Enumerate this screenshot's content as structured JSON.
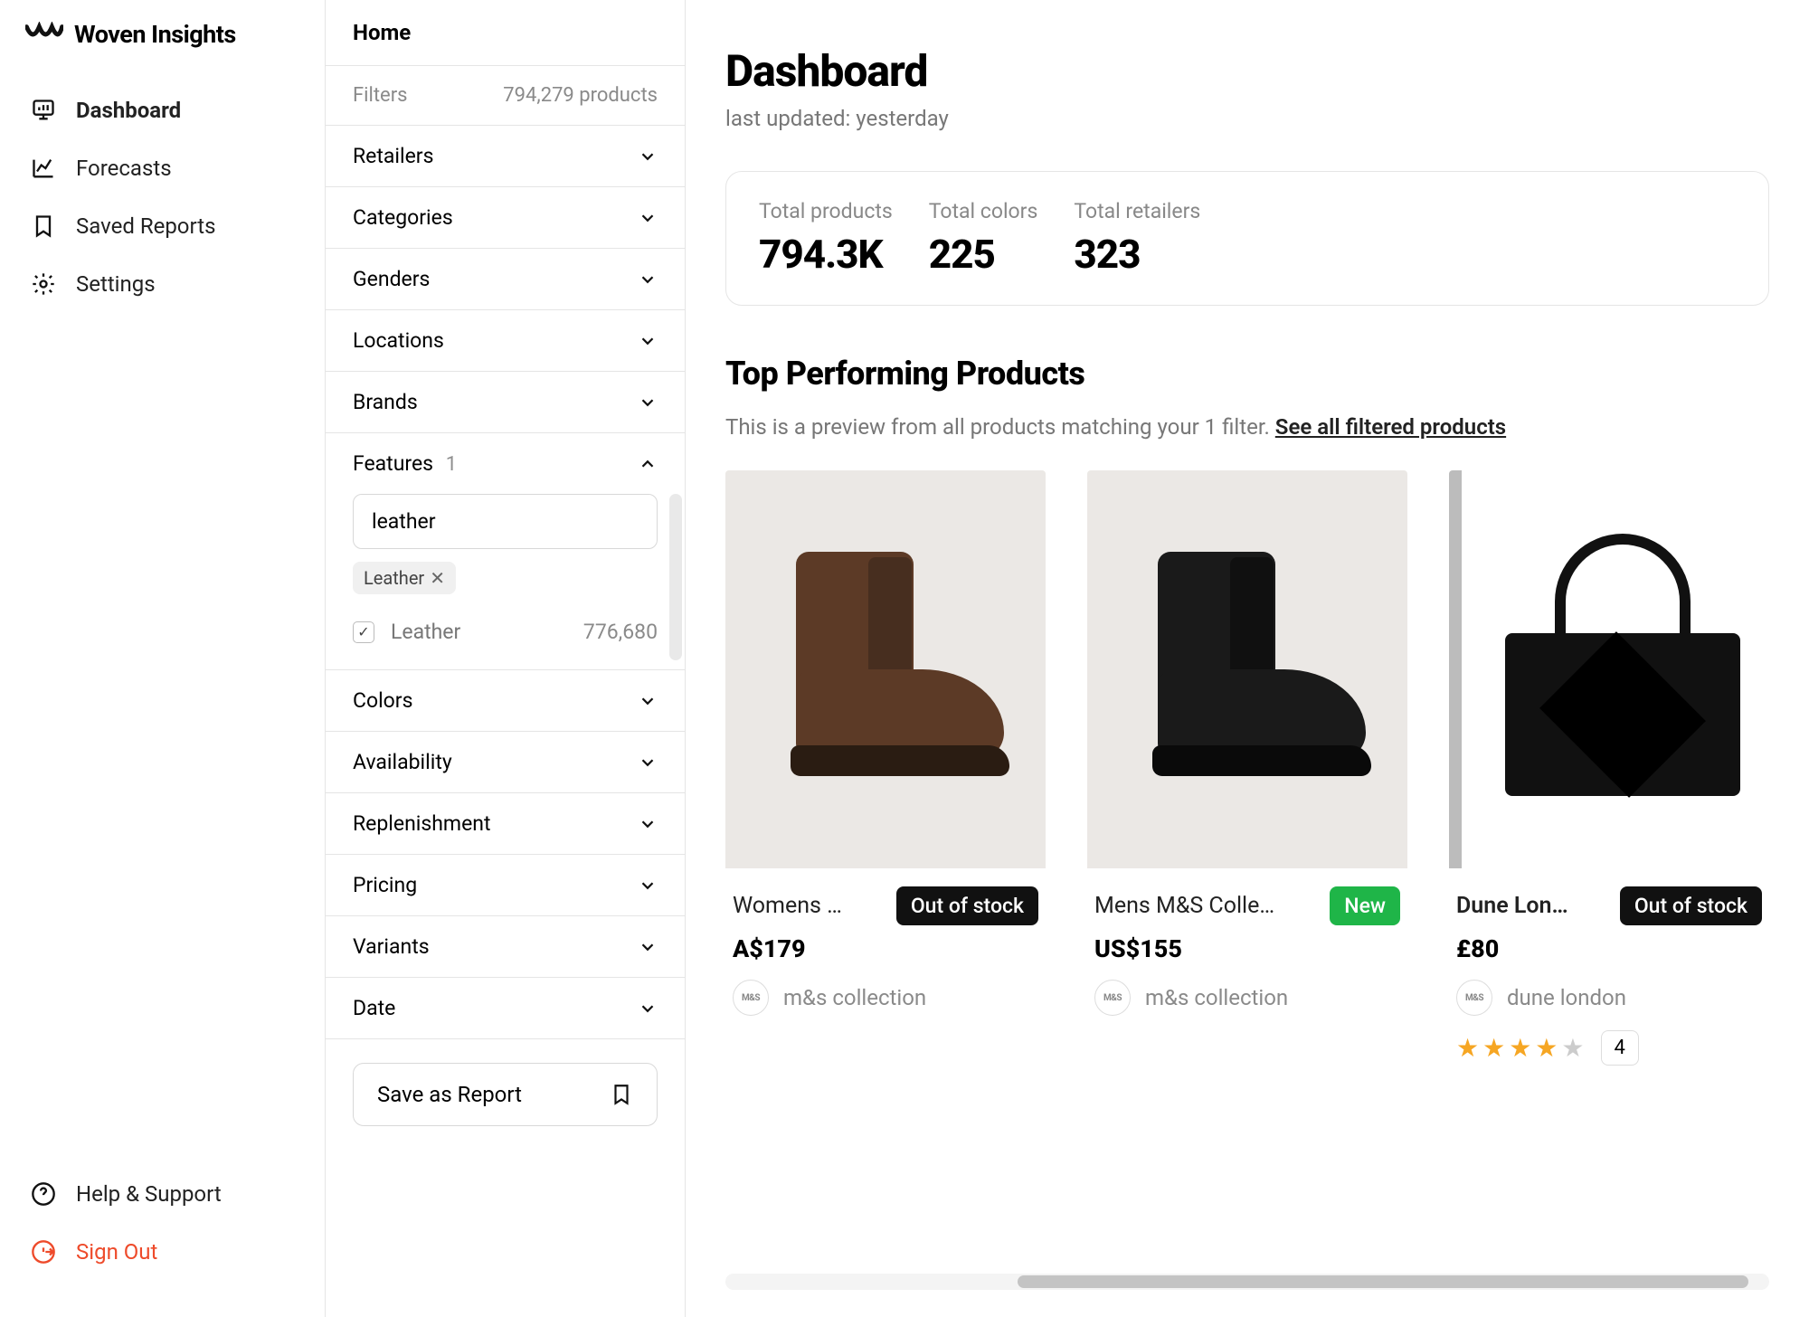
{
  "brand": "Woven Insights",
  "header": {
    "home": "Home"
  },
  "nav": {
    "dashboard": "Dashboard",
    "forecasts": "Forecasts",
    "savedReports": "Saved Reports",
    "settings": "Settings"
  },
  "footerNav": {
    "help": "Help & Support",
    "signout": "Sign Out"
  },
  "filters": {
    "label": "Filters",
    "countText": "794,279 products",
    "groups": {
      "retailers": "Retailers",
      "categories": "Categories",
      "genders": "Genders",
      "locations": "Locations",
      "brands": "Brands",
      "features": "Features",
      "colors": "Colors",
      "availability": "Availability",
      "replenishment": "Replenishment",
      "pricing": "Pricing",
      "variants": "Variants",
      "date": "Date"
    },
    "features": {
      "applied": "1",
      "searchValue": "leather",
      "tag": "Leather",
      "option": "Leather",
      "optionCount": "776,680"
    },
    "saveReport": "Save as Report"
  },
  "page": {
    "title": "Dashboard",
    "updated": "last updated: yesterday"
  },
  "stats": {
    "productsLabel": "Total products",
    "productsValue": "794.3K",
    "colorsLabel": "Total colors",
    "colorsValue": "225",
    "retailersLabel": "Total retailers",
    "retailersValue": "323"
  },
  "top": {
    "title": "Top Performing Products",
    "previewText": "This is a preview from all products matching your 1 filter. ",
    "seeAll": "See all filtered products"
  },
  "products": [
    {
      "name": "Womens …",
      "badge": "Out of stock",
      "badgeKind": "dark",
      "price": "A$179",
      "brand": "m&s collection",
      "brandShort": "M&S",
      "imgKind": "brown-boot"
    },
    {
      "name": "Mens M&S Colle…",
      "badge": "New",
      "badgeKind": "green",
      "price": "US$155",
      "brand": "m&s collection",
      "brandShort": "M&S",
      "imgKind": "black-boot"
    },
    {
      "name": "Dune Lon…",
      "badge": "Out of stock",
      "badgeKind": "dark",
      "price": "£80",
      "brand": "dune london",
      "brandShort": "M&S",
      "imgKind": "bag",
      "rating": 4,
      "ratingCount": "4"
    }
  ]
}
